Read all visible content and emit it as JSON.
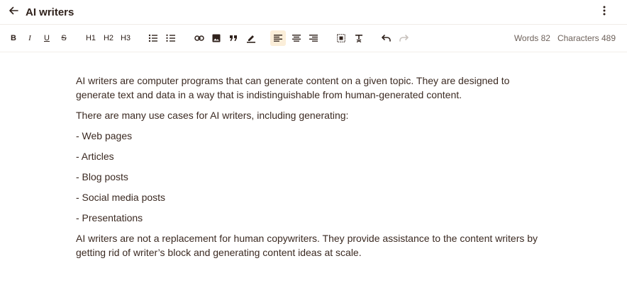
{
  "header": {
    "title": "AI writers",
    "back_icon": "arrow-left-icon",
    "menu_icon": "more-vertical-icon"
  },
  "toolbar": {
    "bold": "B",
    "italic": "I",
    "underline": "U",
    "strike": "S",
    "h1": "H1",
    "h2": "H2",
    "h3": "H3",
    "active_color": "#fbeed9"
  },
  "counts": {
    "words": "Words 82",
    "characters": "Characters 489"
  },
  "document": {
    "paragraphs": [
      "AI writers are computer programs that can generate content on a given topic. They are designed to generate text and data in a way that is indistinguishable from human-generated content.",
      "There are many use cases for AI writers, including generating:",
      "- Web pages",
      "- Articles",
      "- Blog posts",
      "- Social media posts",
      "- Presentations",
      "AI writers are not a replacement for human copywriters. They provide assistance to the content writers by getting rid of writer’s block and generating content ideas at scale."
    ]
  }
}
